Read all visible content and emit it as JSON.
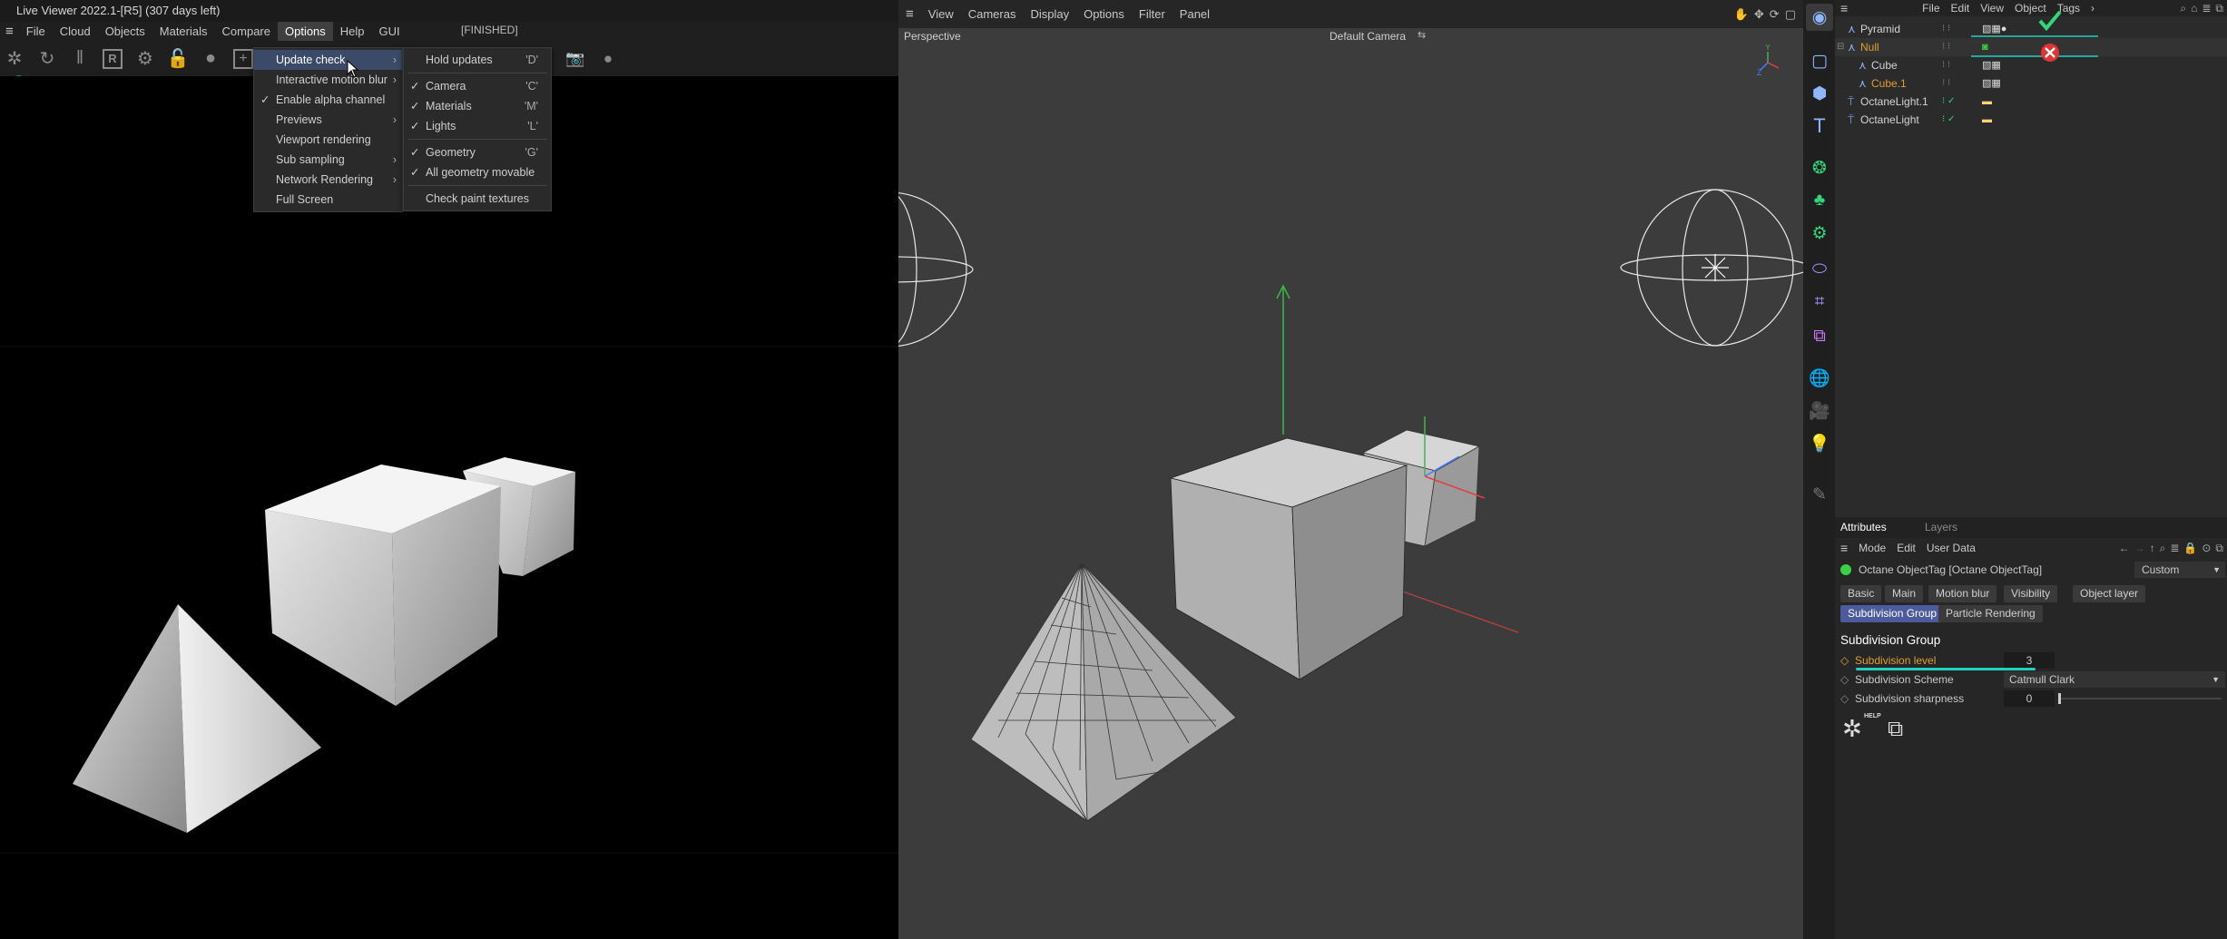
{
  "live_viewer": {
    "title": "Live Viewer 2022.1-[R5] (307 days left)",
    "menu": [
      "File",
      "Cloud",
      "Objects",
      "Materials",
      "Compare",
      "Options",
      "Help",
      "GUI"
    ],
    "active_menu": "Options",
    "status": "[FINISHED]",
    "toolbar_letter": "R",
    "options_menu": [
      {
        "label": "Update check",
        "submenu": true,
        "highlight": true,
        "checked": false
      },
      {
        "label": "Interactive motion blur",
        "submenu": true,
        "checked": false
      },
      {
        "label": "Enable alpha channel",
        "submenu": false,
        "checked": true
      },
      {
        "label": "Previews",
        "submenu": true,
        "checked": false
      },
      {
        "label": "Viewport rendering",
        "submenu": false,
        "checked": false
      },
      {
        "label": "Sub sampling",
        "submenu": true,
        "checked": false
      },
      {
        "label": "Network Rendering",
        "submenu": true,
        "checked": false
      },
      {
        "label": "Full Screen",
        "submenu": false,
        "checked": false
      }
    ],
    "update_check_menu": [
      {
        "label": "Hold updates",
        "key": "'D'",
        "checked": false
      },
      {
        "sep": true
      },
      {
        "label": "Camera",
        "key": "'C'",
        "checked": true
      },
      {
        "label": "Materials",
        "key": "'M'",
        "checked": true
      },
      {
        "label": "Lights",
        "key": "'L'",
        "checked": true
      },
      {
        "sep": true
      },
      {
        "label": "Geometry",
        "key": "'G'",
        "checked": true
      },
      {
        "label": "All geometry movable",
        "key": "",
        "checked": true
      },
      {
        "sep": true
      },
      {
        "label": "Check paint textures",
        "key": "",
        "checked": false
      }
    ]
  },
  "viewport": {
    "menu": [
      "View",
      "Cameras",
      "Display",
      "Options",
      "Filter",
      "Panel"
    ],
    "view_name": "Perspective",
    "camera": "Default Camera"
  },
  "object_manager": {
    "menu": [
      "File",
      "Edit",
      "View",
      "Object",
      "Tags"
    ],
    "objects": [
      {
        "name": "Pyramid",
        "color": "#d4d4d4",
        "indent": 0
      },
      {
        "name": "Null",
        "color": "#e0a030",
        "indent": 0,
        "selected": true
      },
      {
        "name": "Cube",
        "color": "#d4d4d4",
        "indent": 1
      },
      {
        "name": "Cube.1",
        "color": "#e0a030",
        "indent": 1
      },
      {
        "name": "OctaneLight.1",
        "color": "#d4d4d4",
        "indent": 0
      },
      {
        "name": "OctaneLight",
        "color": "#d4d4d4",
        "indent": 0
      }
    ]
  },
  "attributes": {
    "tabs": [
      "Attributes",
      "Layers"
    ],
    "menu": [
      "Mode",
      "Edit",
      "User Data"
    ],
    "object_label": "Octane ObjectTag [Octane ObjectTag]",
    "preset": "Custom",
    "group_tabs": [
      "Basic",
      "Main",
      "Motion blur",
      "Visibility",
      "Object layer",
      "Subdivision Group",
      "Particle Rendering"
    ],
    "active_group": "Subdivision Group",
    "section_title": "Subdivision Group",
    "params": [
      {
        "label": "Subdivision level",
        "value": "3",
        "highlight": true
      },
      {
        "label": "Subdivision Scheme",
        "value": "Catmull Clark"
      },
      {
        "label": "Subdivision sharpness",
        "value": "0"
      }
    ],
    "help_label": "HELP"
  },
  "colors": {
    "accent_blue": "#3a4a68",
    "active_tab": "#4d5b9c",
    "orange": "#e0a030",
    "check_green": "#33d67a",
    "cross_red": "#e03434",
    "teal": "#1fd1c0"
  }
}
